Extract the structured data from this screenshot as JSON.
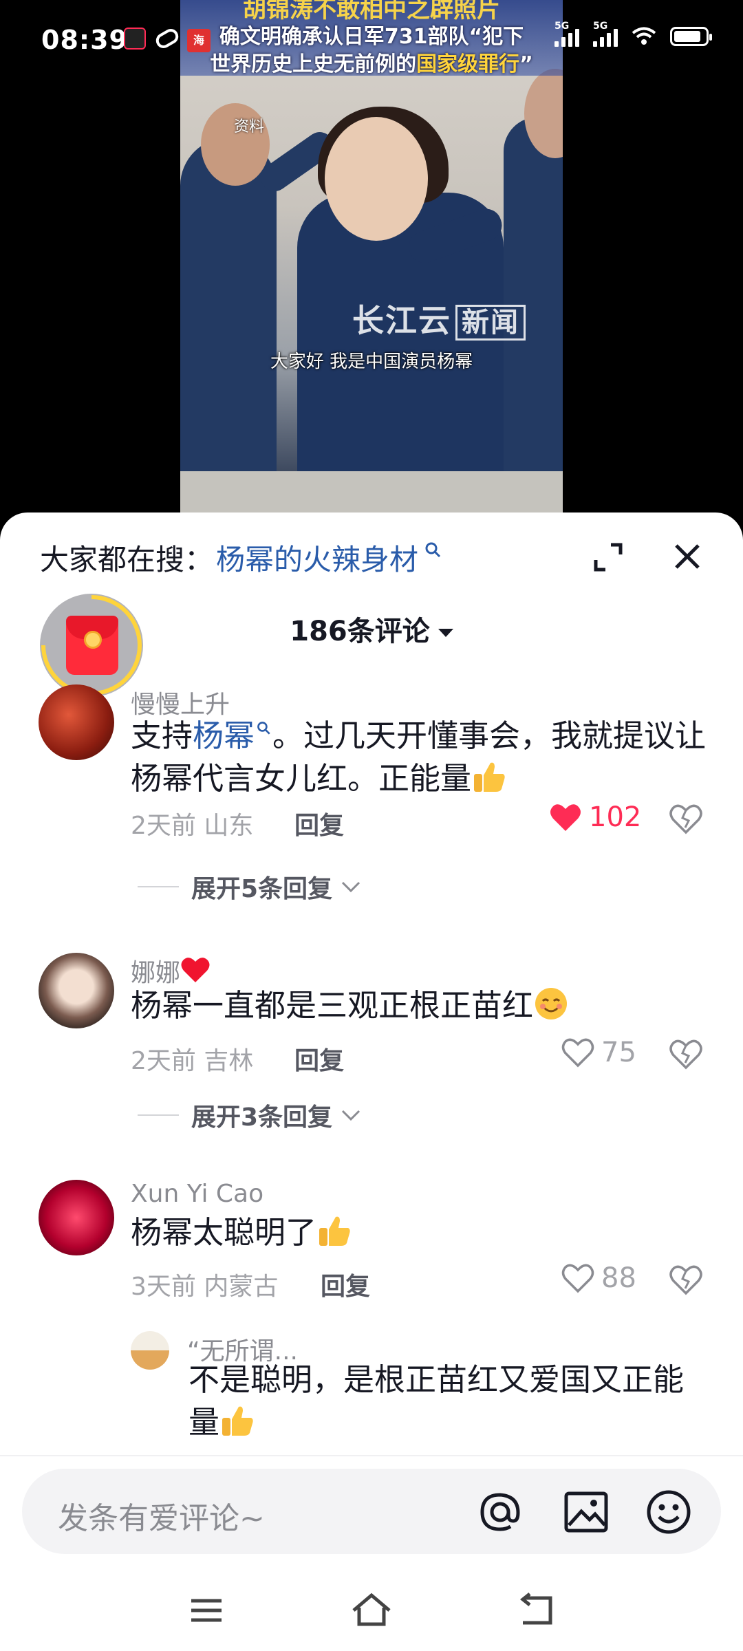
{
  "status_bar": {
    "time": "08:39",
    "signal_1": "5G",
    "signal_2": "5G"
  },
  "video": {
    "title_top": "胡锦涛不敢相中之辟照片",
    "title_line1": "确文明确承认日军731部队“犯下",
    "title_line2_prefix": "世界历史上史无前例的",
    "title_line2_em": "国家级罪行",
    "title_line2_suffix": "”",
    "news_logo": "海",
    "ref_label": "资料",
    "watermark": "长江云",
    "watermark_box": "新闻",
    "subtitle": "大家好 我是中国演员杨幂"
  },
  "search": {
    "prefix": "大家都在搜：",
    "term": "杨幂的火辣身材"
  },
  "comments_header": "186条评论",
  "comments": [
    {
      "name": "慢慢上升",
      "text_pre": "支持",
      "text_hl": "杨幂",
      "text_post": "。过几天开懂事会，我就提议让杨幂代言女儿红。正能量",
      "time_location": "2天前 山东",
      "reply": "回复",
      "likes": "102",
      "liked": true,
      "expand": "展开5条回复"
    },
    {
      "name": "娜娜",
      "text": "杨幂一直都是三观正根正苗红",
      "time_location": "2天前 吉林",
      "reply": "回复",
      "likes": "75",
      "liked": false,
      "expand": "展开3条回复"
    },
    {
      "name": "Xun Yi Cao",
      "text": "杨幂太聪明了",
      "time_location": "3天前 内蒙古",
      "reply": "回复",
      "likes": "88",
      "liked": false
    }
  ],
  "sub_reply": {
    "name": "“无所谓...",
    "text": "不是聪明，是根正苗红又爱国又正能量"
  },
  "input": {
    "placeholder": "发条有爱评论~"
  },
  "colors": {
    "accent_link": "#2a5caa",
    "like_active": "#fe2c55",
    "text_primary": "#161823",
    "text_secondary": "#8a8b91"
  }
}
